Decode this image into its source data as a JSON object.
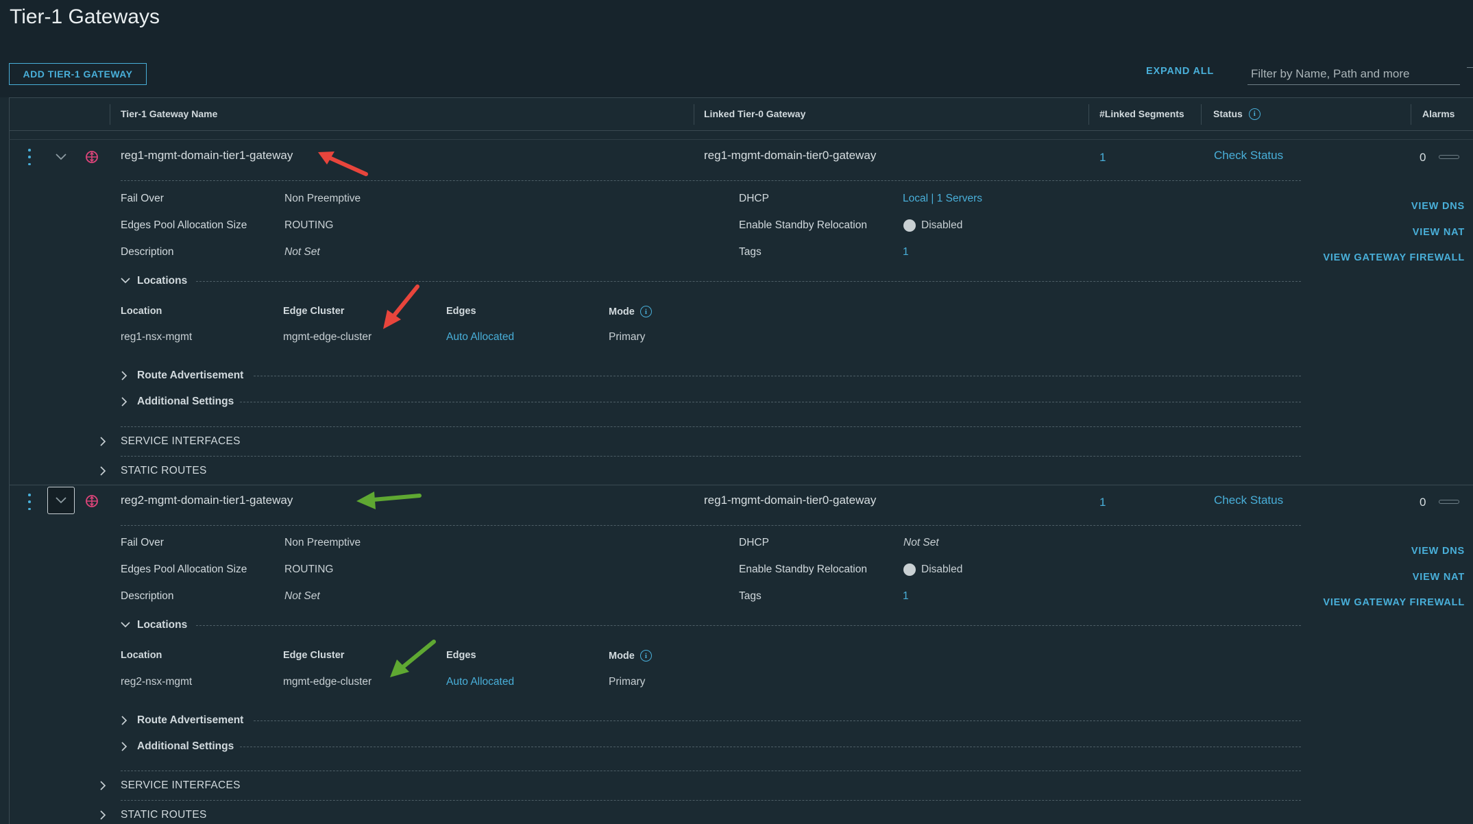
{
  "page": {
    "title": "Tier-1 Gateways"
  },
  "toolbar": {
    "add_label": "ADD TIER-1 GATEWAY",
    "expand_all": "EXPAND ALL",
    "filter_placeholder": "Filter by Name, Path and more"
  },
  "columns": {
    "name": "Tier-1 Gateway Name",
    "linked_t0": "Linked Tier-0 Gateway",
    "linked_segments": "#Linked Segments",
    "status": "Status",
    "alarms": "Alarms"
  },
  "detail_labels": {
    "fail_over": "Fail Over",
    "edges_pool": "Edges Pool Allocation Size",
    "description": "Description",
    "dhcp": "DHCP",
    "standby": "Enable Standby Relocation",
    "tags": "Tags",
    "locations": "Locations",
    "location": "Location",
    "edge_cluster": "Edge Cluster",
    "edges": "Edges",
    "mode": "Mode",
    "route_adv": "Route Advertisement",
    "additional": "Additional Settings",
    "service_interfaces": "SERVICE INTERFACES",
    "static_routes": "STATIC ROUTES",
    "view_dns": "VIEW DNS",
    "view_nat": "VIEW NAT",
    "view_firewall": "VIEW GATEWAY FIREWALL"
  },
  "gateways": [
    {
      "name": "reg1-mgmt-domain-tier1-gateway",
      "linked_t0": "reg1-mgmt-domain-tier0-gateway",
      "linked_segments": "1",
      "status": "Check Status",
      "alarms": "0",
      "fail_over": "Non Preemptive",
      "edges_pool": "ROUTING",
      "description": "Not Set",
      "dhcp": "Local | 1 Servers",
      "standby": "Disabled",
      "tags": "1",
      "location": "reg1-nsx-mgmt",
      "edge_cluster": "mgmt-edge-cluster",
      "edges": "Auto Allocated",
      "mode": "Primary",
      "arrow_color": "#e8453c"
    },
    {
      "name": "reg2-mgmt-domain-tier1-gateway",
      "linked_t0": "reg1-mgmt-domain-tier0-gateway",
      "linked_segments": "1",
      "status": "Check Status",
      "alarms": "0",
      "fail_over": "Non Preemptive",
      "edges_pool": "ROUTING",
      "description": "Not Set",
      "dhcp": "Not Set",
      "standby": "Disabled",
      "tags": "1",
      "location": "reg2-nsx-mgmt",
      "edge_cluster": "mgmt-edge-cluster",
      "edges": "Auto Allocated",
      "mode": "Primary",
      "arrow_color": "#5fa832"
    }
  ],
  "colors": {
    "accent": "#49afd9",
    "background": "#1b2a32",
    "gateway_icon": "#e0457b"
  }
}
